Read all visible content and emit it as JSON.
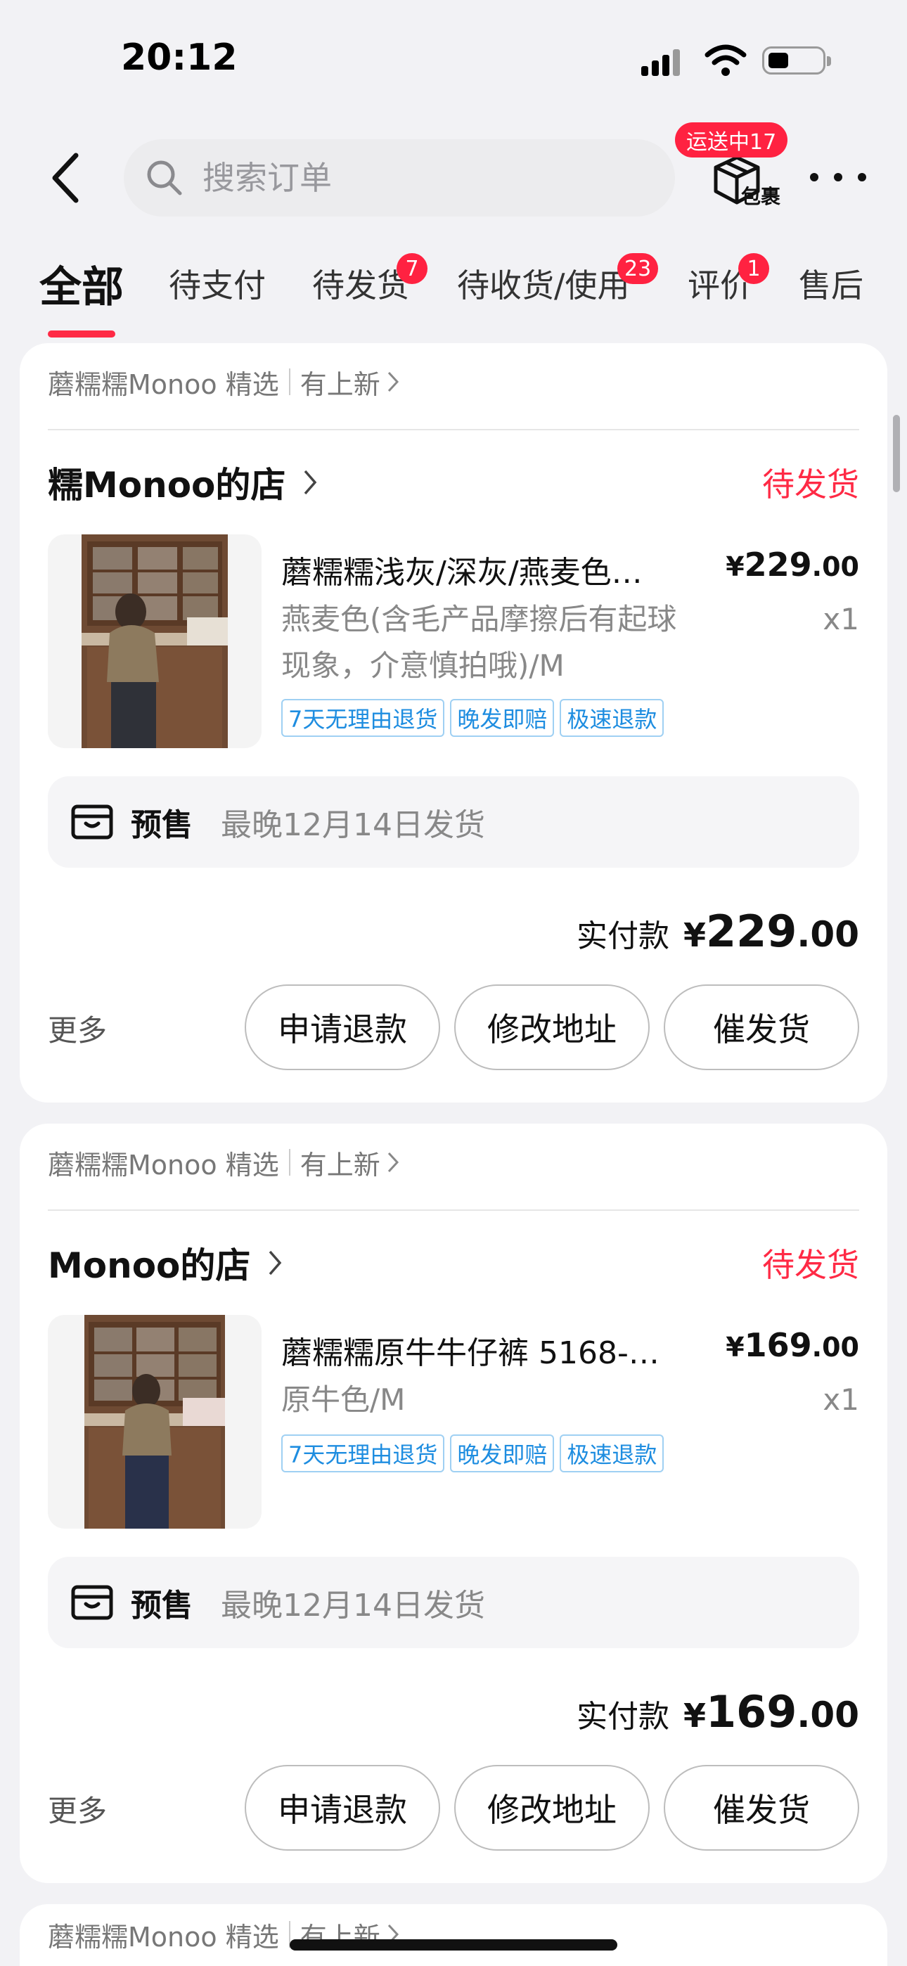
{
  "status_bar": {
    "time": "20:12"
  },
  "header": {
    "search_placeholder": "搜索订单",
    "package_label": "包裹",
    "package_badge": "运送中17"
  },
  "tabs": [
    {
      "label": "全部",
      "active": true
    },
    {
      "label": "待支付"
    },
    {
      "label": "待发货",
      "badge": "7"
    },
    {
      "label": "待收货/使用",
      "badge": "23"
    },
    {
      "label": "评价",
      "badge": "1"
    },
    {
      "label": "售后"
    }
  ],
  "orders": [
    {
      "store_banner": "蘑糯糯Monoo 精选",
      "banner_link": "有上新",
      "shop_name": "糯Monoo的店",
      "status": "待发货",
      "product_title": "蘑糯糯浅灰/深灰/燕麦色…",
      "price_currency": "¥",
      "price_int": "229",
      "price_dec": ".00",
      "spec_line1": "燕麦色(含毛产品摩擦后有起球",
      "spec_line2": "现象，介意慎拍哦)/M",
      "qty": "x1",
      "tags": [
        "7天无理由退货",
        "晚发即赔",
        "极速退款"
      ],
      "presale_label": "预售",
      "presale_text": "最晚12月14日发货",
      "paid_label": "实付款",
      "paid_currency": "¥",
      "paid_int": "229",
      "paid_dec": ".00",
      "more": "更多",
      "btn_refund": "申请退款",
      "btn_address": "修改地址",
      "btn_urge": "催发货"
    },
    {
      "store_banner": "蘑糯糯Monoo 精选",
      "banner_link": "有上新",
      "shop_name": "Monoo的店",
      "status": "待发货",
      "product_title": "蘑糯糯原牛牛仔裤 5168-…",
      "price_currency": "¥",
      "price_int": "169",
      "price_dec": ".00",
      "spec_line1": "原牛色/M",
      "spec_line2": "",
      "qty": "x1",
      "tags": [
        "7天无理由退货",
        "晚发即赔",
        "极速退款"
      ],
      "presale_label": "预售",
      "presale_text": "最晚12月14日发货",
      "paid_label": "实付款",
      "paid_currency": "¥",
      "paid_int": "169",
      "paid_dec": ".00",
      "more": "更多",
      "btn_refund": "申请退款",
      "btn_address": "修改地址",
      "btn_urge": "催发货"
    },
    {
      "store_banner": "蘑糯糯Monoo 精选",
      "banner_link": "有上新"
    }
  ],
  "colors": {
    "accent": "#ff2a45",
    "badge": "#ff2241",
    "tag_blue": "#1e8de0",
    "background": "#f2f2f5"
  }
}
